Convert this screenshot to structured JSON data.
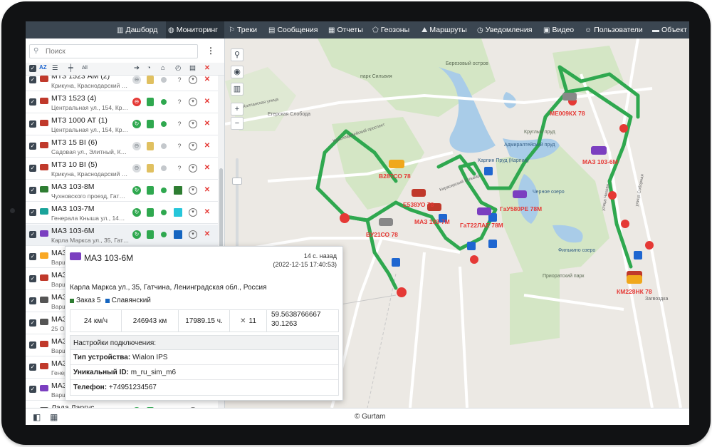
{
  "nav": {
    "items": [
      {
        "label": "Дашборд",
        "icon": "dashboard-icon",
        "glyph": "▥",
        "active": false
      },
      {
        "label": "Мониторинг",
        "icon": "globe-icon",
        "glyph": "◍",
        "active": true
      },
      {
        "label": "Треки",
        "icon": "tracks-icon",
        "glyph": "⚐",
        "active": false
      },
      {
        "label": "Сообщения",
        "icon": "messages-icon",
        "glyph": "▤",
        "active": false
      },
      {
        "label": "Отчеты",
        "icon": "reports-icon",
        "glyph": "▦",
        "active": false
      },
      {
        "label": "Геозоны",
        "icon": "geozones-icon",
        "glyph": "⬠",
        "active": false
      },
      {
        "label": "Маршруты",
        "icon": "routes-icon",
        "glyph": "⛰",
        "active": false
      },
      {
        "label": "Уведомления",
        "icon": "notifications-icon",
        "glyph": "◷",
        "active": false
      },
      {
        "label": "Видео",
        "icon": "video-icon",
        "glyph": "▣",
        "active": false
      },
      {
        "label": "Пользователи",
        "icon": "users-icon",
        "glyph": "☺",
        "active": false
      },
      {
        "label": "Объект",
        "icon": "units-icon",
        "glyph": "▬",
        "active": false
      }
    ]
  },
  "search": {
    "placeholder": "Поиск"
  },
  "toolbar": {
    "sort_label": "AZ",
    "all_label": "All"
  },
  "units": [
    {
      "name": "МТЗ 1523 АМ (2)",
      "address": "Крикуна, Краснодарский …",
      "color": "#c0392b",
      "status": "gray",
      "row_color": ""
    },
    {
      "name": "МТЗ 1523 (4)",
      "address": "Центральная ул., 154, Кр…",
      "color": "#c0392b",
      "status": "red",
      "row_color": ""
    },
    {
      "name": "МТЗ 1000 АТ (1)",
      "address": "Центральная ул., 154, Кр…",
      "color": "#c0392b",
      "status": "green",
      "row_color": ""
    },
    {
      "name": "МТЗ 15 BI (6)",
      "address": "Садовая ул., Элитный, К…",
      "color": "#c0392b",
      "status": "gray",
      "row_color": ""
    },
    {
      "name": "МТЗ 10 BI (5)",
      "address": "Крикуна, Краснодарский …",
      "color": "#c0392b",
      "status": "gray",
      "row_color": ""
    },
    {
      "name": "МАЗ 103-8М",
      "address": "Чухновского проезд, Гат…",
      "color": "#2e7d32",
      "status": "green",
      "row_color": "#2e7d32"
    },
    {
      "name": "МАЗ 103-7М",
      "address": "Генерала Кныша ул., 14…",
      "color": "#1aa39a",
      "status": "green",
      "row_color": "#26c6da"
    },
    {
      "name": "МАЗ 103-6М",
      "address": "Карла Маркса ул., 35, Гат…",
      "color": "#7b3fc0",
      "status": "green",
      "row_color": "#1565c0"
    },
    {
      "name": "МАЗ 103-5М",
      "address": "Варшавская ул., 2, Гатч…",
      "color": "#f9a825",
      "status": "green",
      "row_color": ""
    },
    {
      "name": "МАЗ 103-4М",
      "address": "Варшавская ул., 10, Гат…",
      "color": "#c0392b",
      "status": "green",
      "row_color": ""
    },
    {
      "name": "МАЗ 103-3М",
      "address": "Варшавская ул., 21, Гат…",
      "color": "#555555",
      "status": "green",
      "row_color": ""
    },
    {
      "name": "МАЗ 103-2М",
      "address": "25 Октября пр., Гатчина…",
      "color": "#555555",
      "status": "green",
      "row_color": ""
    },
    {
      "name": "МАЗ 103-1М",
      "address": "Варшавская ул., 7, Гатч…",
      "color": "#c0392b",
      "status": "green",
      "row_color": ""
    },
    {
      "name": "МАЗ 103-0М",
      "address": "Генерала Кныша ул., 2, …",
      "color": "#c0392b",
      "status": "green",
      "row_color": ""
    },
    {
      "name": "МАЗ 203",
      "address": "Варшавская ул., 12, Гат…",
      "color": "#7b3fc0",
      "status": "green",
      "row_color": ""
    },
    {
      "name": "Лада Ларгус",
      "address": "МКАД, 47-й км, Москва…",
      "color": "#555555",
      "status": "green",
      "row_color": ""
    }
  ],
  "popup": {
    "title": "МАЗ 103-6М",
    "ago": "14 с. назад",
    "datetime": "(2022-12-15 17:40:53)",
    "address": "Карла Маркса ул., 35, Гатчина, Ленинградская обл., Россия",
    "tag1": "Заказ 5",
    "tag2": "Славянский",
    "speed": "24 км/ч",
    "mileage": "246943 км",
    "hours": "17989.15 ч.",
    "sats": "11",
    "lat": "59.5638766667",
    "lon": "30.1263",
    "conn_header": "Настройки подключения:",
    "device_type_label": "Тип устройства:",
    "device_type": "Wialon IPS",
    "uid_label": "Уникальный ID:",
    "uid": "m_ru_sim_m6",
    "phone_label": "Телефон:",
    "phone": "+74951234567"
  },
  "map": {
    "labels": {
      "park_silvia": "парк Сильвия",
      "egerskaya": "Егерская Слобода",
      "berezovy": "Березовый остров",
      "krugly": "Круглый пруд",
      "admiral": "Адмиралтейский пруд",
      "karpin": "Карпин Пруд (Карпии)",
      "chernoe": "Черное озеро",
      "filkino": "Филькино озеро",
      "priorat": "Приоратский парк",
      "zagvozka": "Загвоздка",
      "kirasirsky": "Кирасирский бульвар",
      "krasnoarm": "Красноармейский проспект",
      "kolpanskaya": "Колпанская улица",
      "chehova": "улица Чехова",
      "sobornaya": "улица Соборная"
    },
    "vehicles": [
      {
        "plate": "В287СО 78",
        "color": "#f0a81c"
      },
      {
        "plate": "Е538УО 78",
        "color": "#c0392b"
      },
      {
        "plate": "МАЗ 103-7М",
        "color": "#c0392b"
      },
      {
        "plate": "ВУ21СО 78",
        "color": "#888888"
      },
      {
        "plate": "ГаТ22ЛАЕ 78М",
        "color": "#7b3fc0"
      },
      {
        "plate": "ГаУ580РЕ 78М",
        "color": "#7b3fc0"
      },
      {
        "plate": "МЕ009КХ 78",
        "color": "#888888"
      },
      {
        "plate": "МАЗ 103-6М",
        "color": "#7b3fc0"
      },
      {
        "plate": "КМ228НК 78",
        "color": "#c0392b"
      }
    ],
    "zoom_in": "+",
    "zoom_out": "−"
  },
  "footer": {
    "copyright": "© Gurtam"
  },
  "colors": {
    "topbar": "#3b4651",
    "route": "#2fa84f",
    "accent_red": "#e53935"
  }
}
